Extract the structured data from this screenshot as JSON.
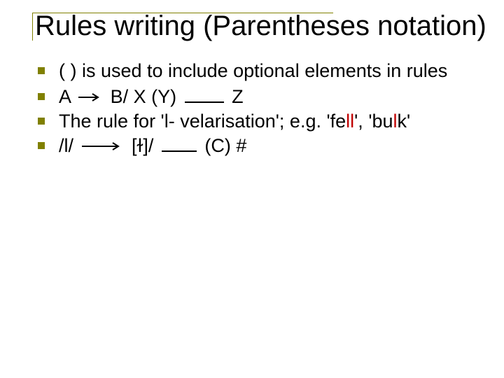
{
  "title": "Rules writing (Parentheses notation)",
  "bullets": {
    "b1": "( ) is used to include optional elements in rules",
    "b2": {
      "pre": "A",
      "post": "B/ X (Y)",
      "tail": " Z"
    },
    "b3": {
      "pre": "The rule for 'l- velarisation'; e.g. 'fe",
      "red1": "ll",
      "mid": "', 'bu",
      "red2": "l",
      "post": "k'"
    },
    "b4": {
      "pre": "/l/",
      "post": "[ɫ]/ ",
      "tail": " (C) #"
    }
  }
}
